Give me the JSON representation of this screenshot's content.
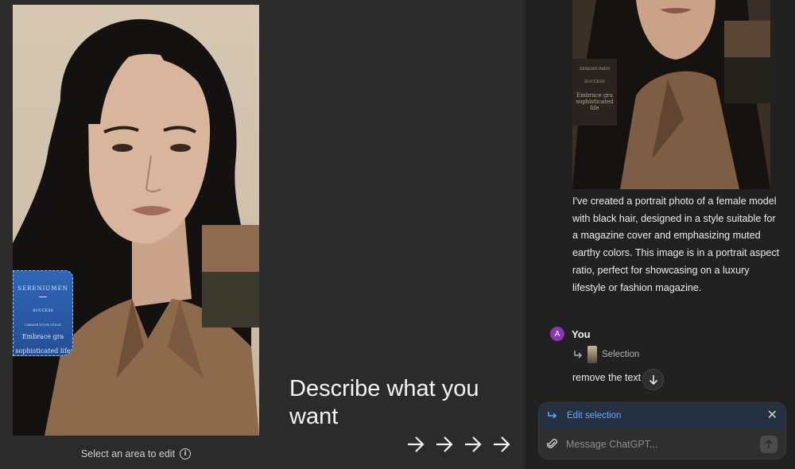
{
  "editor": {
    "select_hint": "Select an area to edit",
    "describe_text": "Describe what you want",
    "sticker": {
      "title": "SERENIUMEN",
      "line2": "SUCCESS",
      "line3": "CREATE YOUR STYLE",
      "line4": "Embrace gra",
      "line5": "sophisticated life"
    }
  },
  "chat": {
    "thumb_sticker": {
      "title": "SERENIUMEN",
      "line2": "SUCCESS",
      "line3": "Embrace gra",
      "line4": "sophisticated life"
    },
    "assistant_reply": "I've created a portrait photo of a female model with black hair, designed in a style suitable for a magazine cover and emphasizing muted earthy colors. This image is in a portrait aspect ratio, perfect for showcasing on a luxury lifestyle or fashion magazine.",
    "user": {
      "initial": "A",
      "name": "You",
      "selection_label": "Selection",
      "message": "remove the text l    k"
    },
    "composer": {
      "edit_label": "Edit selection",
      "placeholder": "Message ChatGPT..."
    }
  },
  "colors": {
    "accent_blue": "#6aa9ff",
    "avatar_purple": "#8e34b8",
    "chat_bg": "#212121",
    "editor_bg": "#2b2b2b"
  }
}
